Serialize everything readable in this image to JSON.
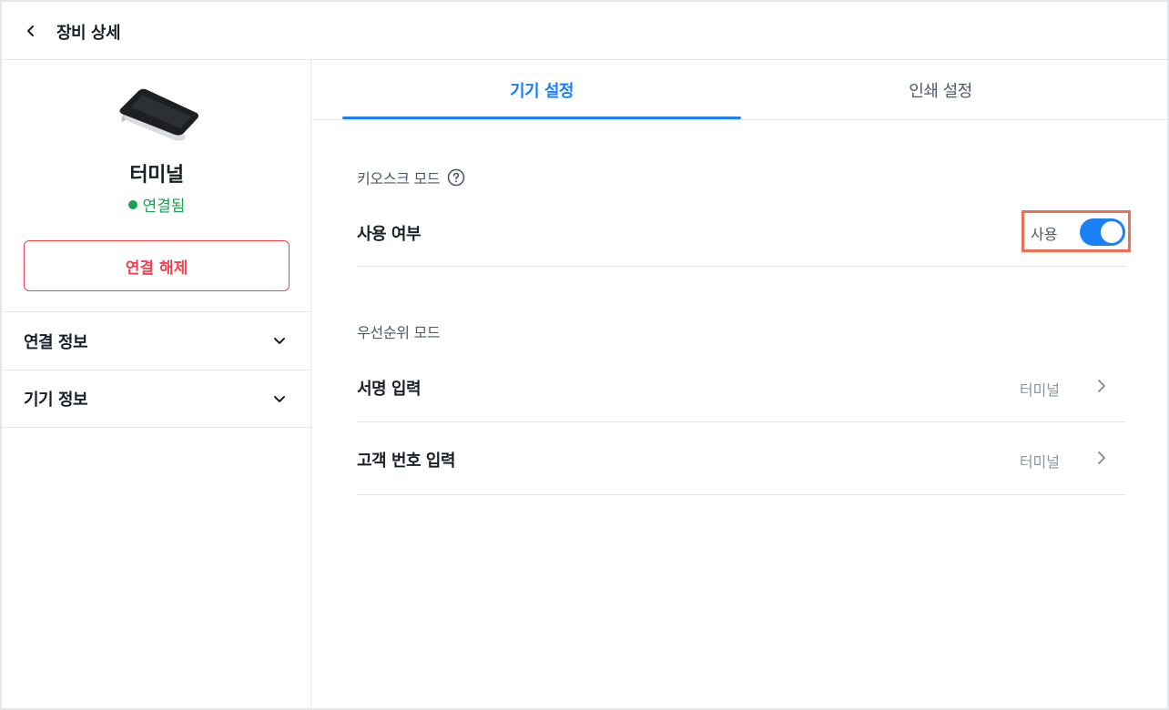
{
  "header": {
    "title": "장비 상세",
    "back_icon": "chevron-left-icon"
  },
  "device": {
    "name": "터미널",
    "status": "연결됨",
    "status_color": "#1aa053",
    "disconnect_label": "연결 해제",
    "disconnect_color": "#f04452"
  },
  "sidebar": {
    "sections": [
      {
        "label": "연결 정보",
        "icon": "chevron-down-icon"
      },
      {
        "label": "기기 정보",
        "icon": "chevron-down-icon"
      }
    ]
  },
  "tabs": [
    {
      "label": "기기 설정",
      "active": true
    },
    {
      "label": "인쇄 설정",
      "active": false
    }
  ],
  "accent_color": "#1b7ff5",
  "kiosk": {
    "section_label": "키오스크 모드",
    "help_icon": "question-circle-icon",
    "use_label": "사용 여부",
    "toggle_text": "사용",
    "toggle_on": true
  },
  "priority": {
    "section_label": "우선순위 모드",
    "items": [
      {
        "label": "서명 입력",
        "value": "터미널",
        "icon": "chevron-right-icon"
      },
      {
        "label": "고객 번호 입력",
        "value": "터미널",
        "icon": "chevron-right-icon"
      }
    ]
  }
}
